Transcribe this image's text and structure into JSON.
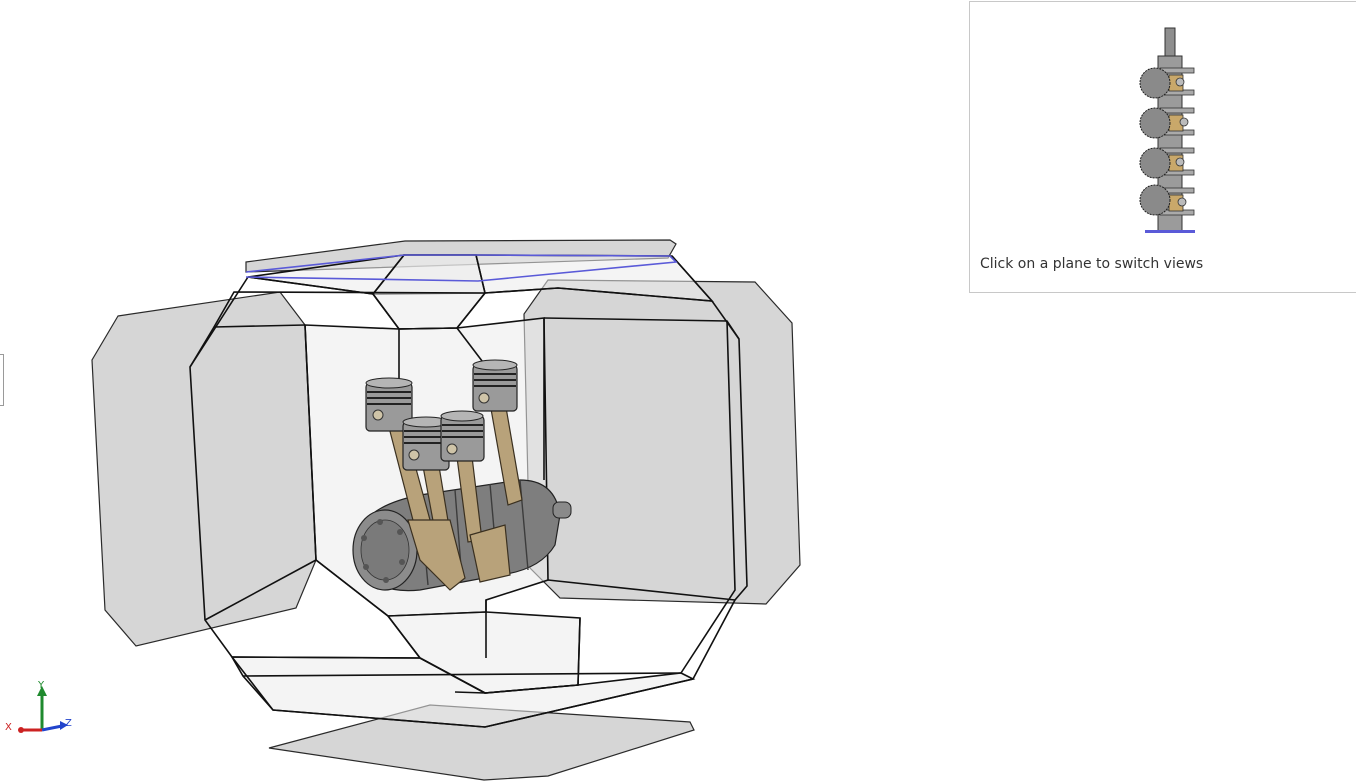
{
  "preview": {
    "caption": "Click on a plane to switch views"
  },
  "triad": {
    "x_label": "X",
    "y_label": "Y",
    "z_label": "Z"
  },
  "colors": {
    "plane_fill": "#cfcfcf",
    "frame_edge": "#111111",
    "highlight_edge": "#5a5ad8",
    "rod_brass": "#b8a27a",
    "metal_gray": "#8e8e8e",
    "axis_x": "#cc2222",
    "axis_y": "#1f8a2e",
    "axis_z": "#2244cc"
  }
}
